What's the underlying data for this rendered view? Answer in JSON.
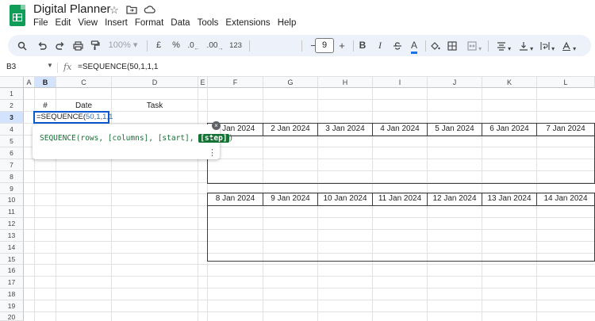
{
  "app": {
    "title": "Digital Planner",
    "icons": [
      "star-icon",
      "move-to-folder-icon",
      "cloud-status-icon"
    ]
  },
  "menu": [
    "File",
    "Edit",
    "View",
    "Insert",
    "Format",
    "Data",
    "Tools",
    "Extensions",
    "Help"
  ],
  "toolbar": {
    "zoom": "100%",
    "currency": "£",
    "percent": "%",
    "decrease_decimals": ".0",
    "increase_decimals": ".00",
    "number_format": "123",
    "font_size": "9",
    "minus": "−",
    "plus": "+",
    "bold": "B",
    "italic": "I",
    "text_color": "A"
  },
  "formula_bar": {
    "name_box": "B3",
    "fx": "fx",
    "formula": "=SEQUENCE(50,1,1,1"
  },
  "columns": [
    "A",
    "B",
    "C",
    "D",
    "E",
    "F",
    "G",
    "H",
    "I",
    "J",
    "K",
    "L"
  ],
  "rows": [
    "1",
    "2",
    "3",
    "4",
    "5",
    "6",
    "7",
    "8",
    "9",
    "10",
    "11",
    "12",
    "13",
    "14",
    "15",
    "16",
    "17",
    "18",
    "19",
    "20"
  ],
  "cells": {
    "b2": "#",
    "c2": "Date",
    "d2": "Task",
    "b3_prefix": "=SEQUENCE(",
    "b3_args": "50,1,1,1"
  },
  "tooltip": {
    "name": "SEQUENCE(",
    "params": "rows, [columns], [start], ",
    "active_param": "[step]",
    "close": ")",
    "expand": "⌄",
    "more": "⋮"
  },
  "calendar": {
    "week1": [
      "1 Jan 2024",
      "2 Jan 2024",
      "3 Jan 2024",
      "4 Jan 2024",
      "5 Jan 2024",
      "6 Jan 2024",
      "7 Jan 2024"
    ],
    "week2": [
      "8 Jan 2024",
      "9 Jan 2024",
      "10 Jan 2024",
      "11 Jan 2024",
      "12 Jan 2024",
      "13 Jan 2024",
      "14 Jan 2024"
    ]
  },
  "colors": {
    "accent_blue": "#0b57d0",
    "toolbar_bg": "#edf2fa",
    "sheets_green": "#0f9d58",
    "tooltip_green": "#137333"
  }
}
